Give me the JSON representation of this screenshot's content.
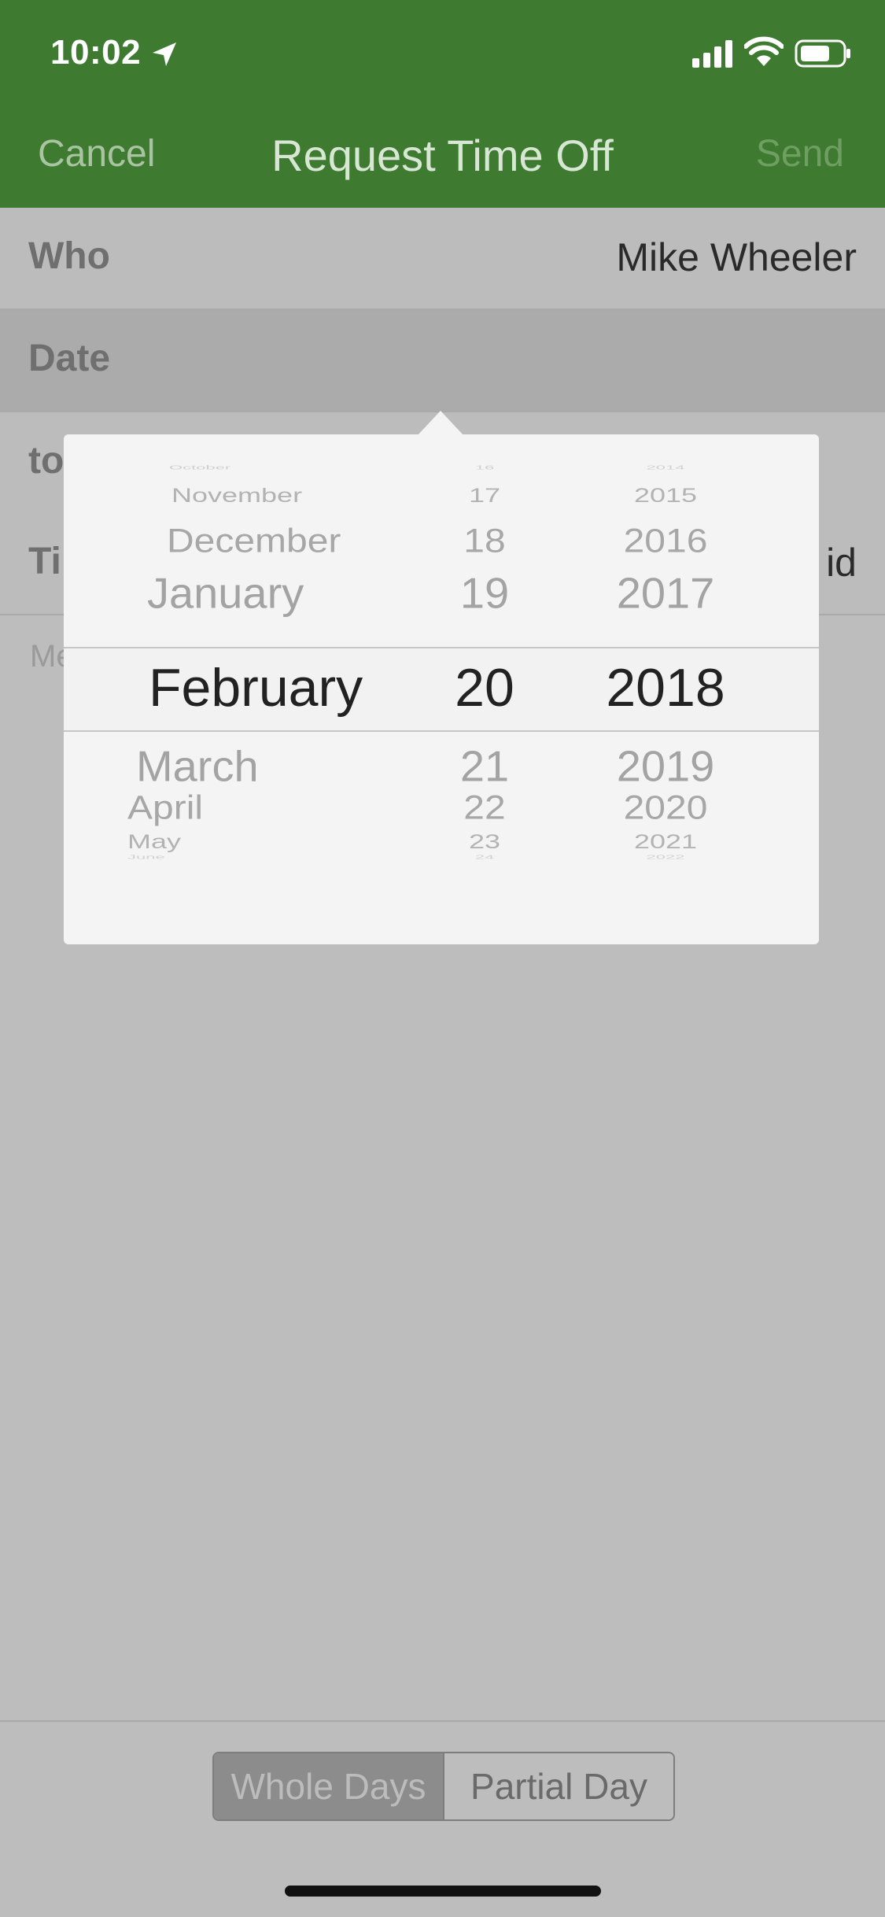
{
  "status_bar": {
    "time": "10:02"
  },
  "nav": {
    "cancel": "Cancel",
    "title": "Request Time Off",
    "send": "Send"
  },
  "form": {
    "who_label": "Who",
    "who_value": "Mike Wheeler",
    "date_label": "Date",
    "to_label": "to",
    "type_label": "Ti",
    "type_value_partial": "id",
    "memo_partial": "Me"
  },
  "picker": {
    "months": [
      "October",
      "November",
      "December",
      "January",
      "February",
      "March",
      "April",
      "May",
      "June"
    ],
    "days": [
      "16",
      "17",
      "18",
      "19",
      "20",
      "21",
      "22",
      "23",
      "24"
    ],
    "years": [
      "2014",
      "2015",
      "2016",
      "2017",
      "2018",
      "2019",
      "2020",
      "2021",
      "2022"
    ],
    "selected": {
      "month": "February",
      "day": "20",
      "year": "2018"
    }
  },
  "segmented": {
    "whole_days": "Whole Days",
    "partial_day": "Partial Day",
    "selected": "Whole Days"
  },
  "colors": {
    "nav_green": "#3e7b30",
    "overlay_gray": "#bdbdbd"
  }
}
